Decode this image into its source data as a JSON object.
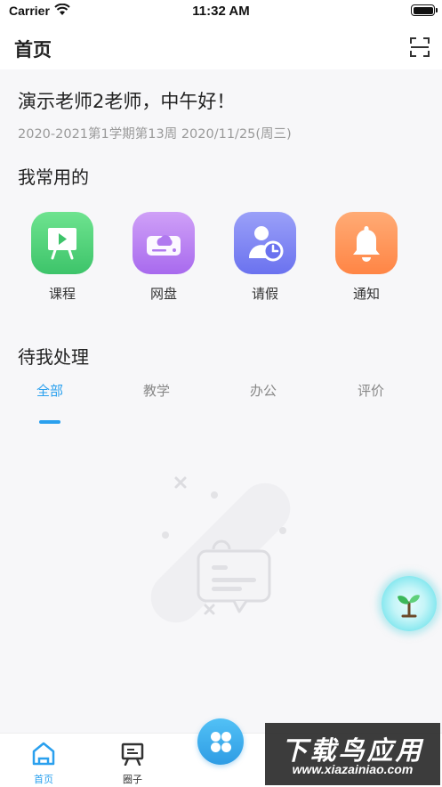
{
  "status_bar": {
    "carrier": "Carrier",
    "time": "11:32 AM"
  },
  "header": {
    "title": "首页",
    "scan_icon": "scan-icon"
  },
  "greeting": {
    "text": "演示老师2老师，中午好！",
    "date_info": "2020-2021第1学期第13周 2020/11/25(周三)"
  },
  "frequent": {
    "title": "我常用的",
    "items": [
      {
        "label": "课程",
        "icon": "course-board-icon",
        "color": "#4fd47a"
      },
      {
        "label": "网盘",
        "icon": "cloud-drive-icon",
        "color": "#b77ef0"
      },
      {
        "label": "请假",
        "icon": "leave-request-icon",
        "color": "#7f86f5"
      },
      {
        "label": "通知",
        "icon": "bell-icon",
        "color": "#ff9254"
      }
    ]
  },
  "pending": {
    "title": "待我处理",
    "tabs": [
      {
        "label": "全部",
        "active": true
      },
      {
        "label": "教学",
        "active": false
      },
      {
        "label": "办公",
        "active": false
      },
      {
        "label": "评价",
        "active": false
      }
    ],
    "accent": "#2aa0ee"
  },
  "tabbar": {
    "items": [
      {
        "label": "首页",
        "icon": "home-icon",
        "active": true
      },
      {
        "label": "圈子",
        "icon": "board-icon",
        "active": false
      }
    ],
    "center_icon": "apps-grid-icon"
  },
  "watermark": {
    "title": "下载鸟应用",
    "url": "www.xiazainiao.com"
  }
}
